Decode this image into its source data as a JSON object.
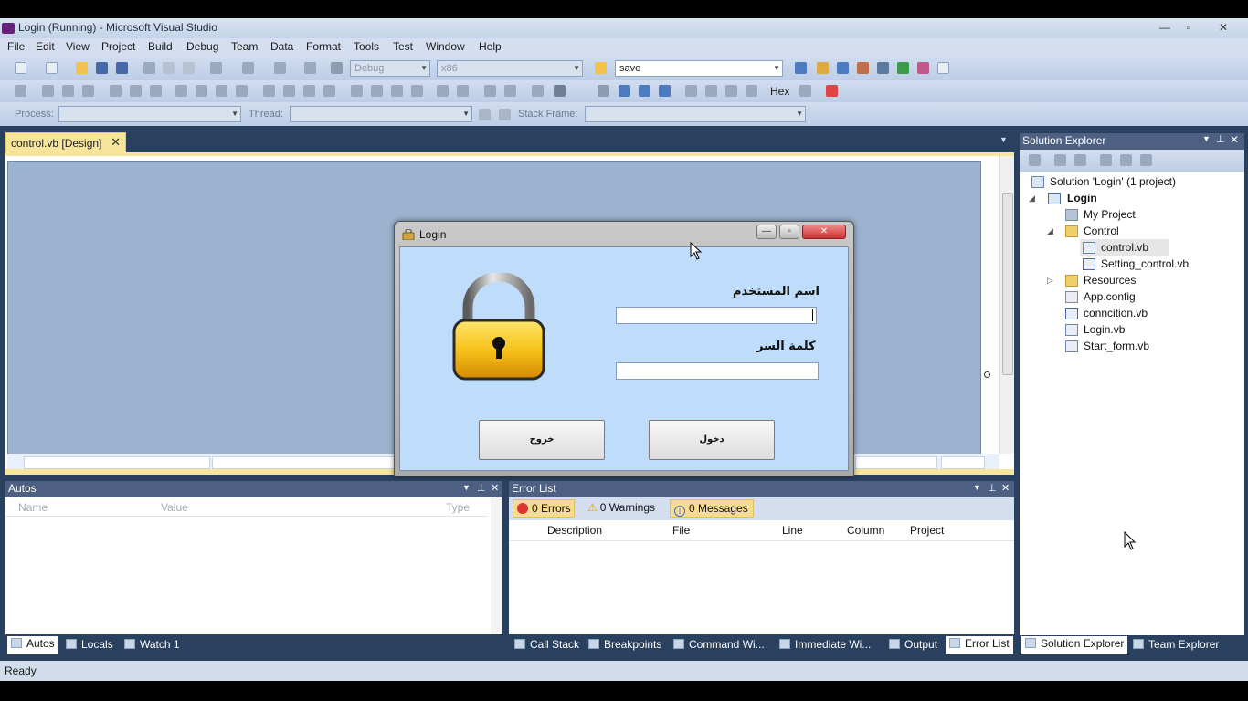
{
  "window": {
    "title": "Login (Running) - Microsoft Visual Studio",
    "controls": {
      "minimize": "—",
      "maximize": "▫",
      "close": "✕"
    }
  },
  "menu": [
    "File",
    "Edit",
    "View",
    "Project",
    "Build",
    "Debug",
    "Team",
    "Data",
    "Format",
    "Tools",
    "Test",
    "Window",
    "Help"
  ],
  "toolbar": {
    "config": "Debug",
    "platform": "x86",
    "find": "save",
    "hex_label": "Hex",
    "process_label": "Process:",
    "thread_label": "Thread:",
    "stack_frame_label": "Stack Frame:"
  },
  "document_tab": {
    "label": "control.vb [Design]",
    "close": "✕"
  },
  "login_dialog": {
    "title": "Login",
    "username_label": "اسم المستخدم",
    "password_label": "كلمة السر",
    "exit_button": "خروج",
    "login_button": "دخول"
  },
  "solution_explorer": {
    "title": "Solution Explorer",
    "items": [
      {
        "label": "Solution 'Login' (1 project)",
        "icon": "solution-icon"
      },
      {
        "label": "Login",
        "icon": "vb-project-icon"
      },
      {
        "label": "My Project",
        "icon": "properties-icon"
      },
      {
        "label": "Control",
        "icon": "folder-icon"
      },
      {
        "label": "control.vb",
        "icon": "form-icon"
      },
      {
        "label": "Setting_control.vb",
        "icon": "vb-file-icon"
      },
      {
        "label": "Resources",
        "icon": "folder-icon"
      },
      {
        "label": "App.config",
        "icon": "config-icon"
      },
      {
        "label": "conncition.vb",
        "icon": "vb-file-icon"
      },
      {
        "label": "Login.vb",
        "icon": "form-icon"
      },
      {
        "label": "Start_form.vb",
        "icon": "form-icon"
      }
    ]
  },
  "autos": {
    "title": "Autos",
    "columns": [
      "Name",
      "Value",
      "Type"
    ]
  },
  "error_list": {
    "title": "Error List",
    "errors": "0 Errors",
    "warnings": "0 Warnings",
    "messages": "0 Messages",
    "columns": [
      "Description",
      "File",
      "Line",
      "Column",
      "Project"
    ]
  },
  "bottom_left_tabs": [
    "Autos",
    "Locals",
    "Watch 1"
  ],
  "bottom_mid_tabs": [
    "Call Stack",
    "Breakpoints",
    "Command Wi...",
    "Immediate Wi...",
    "Output",
    "Error List"
  ],
  "bottom_right_tabs": [
    "Solution Explorer",
    "Team Explorer"
  ],
  "status": "Ready",
  "colors": {
    "panel_header": "#4d6082",
    "ide_background": "#29415e",
    "active_tab": "#f6e59b",
    "dialog_client": "#bfdcfb"
  }
}
